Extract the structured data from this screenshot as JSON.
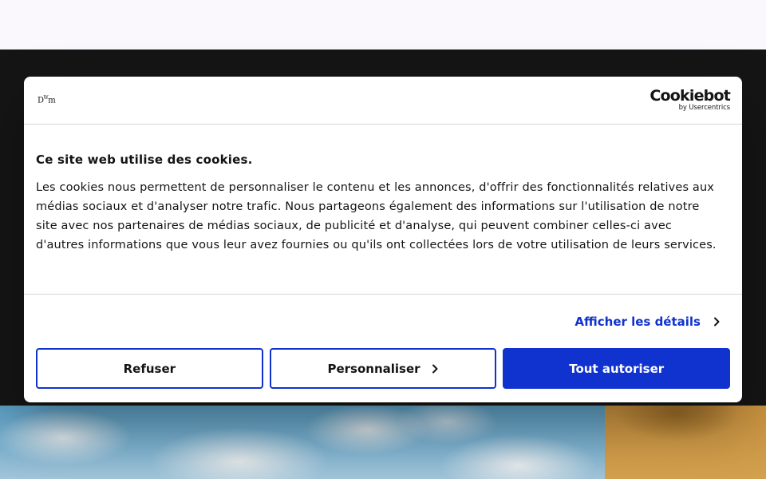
{
  "dialog": {
    "site_logo": "DWm",
    "provider": {
      "name": "Cookiebot",
      "byline": "by Usercentrics"
    },
    "title": "Ce site web utilise des cookies.",
    "body": "Les cookies nous permettent de personnaliser le contenu et les annonces, d'offrir des fonctionnalités relatives aux médias sociaux et d'analyser notre trafic. Nous partageons également des informations sur l'utilisation de notre site avec nos partenaires de médias sociaux, de publicité et d'analyse, qui peuvent combiner celles-ci avec d'autres informations que vous leur avez fournies ou qu'ils ont collectées lors de votre utilisation de leurs services.",
    "details_link": "Afficher les détails",
    "buttons": {
      "reject": "Refuser",
      "customize": "Personnaliser",
      "accept_all": "Tout autoriser"
    },
    "colors": {
      "accent": "#1032cf",
      "text": "#141414"
    }
  },
  "icons": {
    "details": "chevron-right-icon",
    "customize": "chevron-right-icon"
  }
}
